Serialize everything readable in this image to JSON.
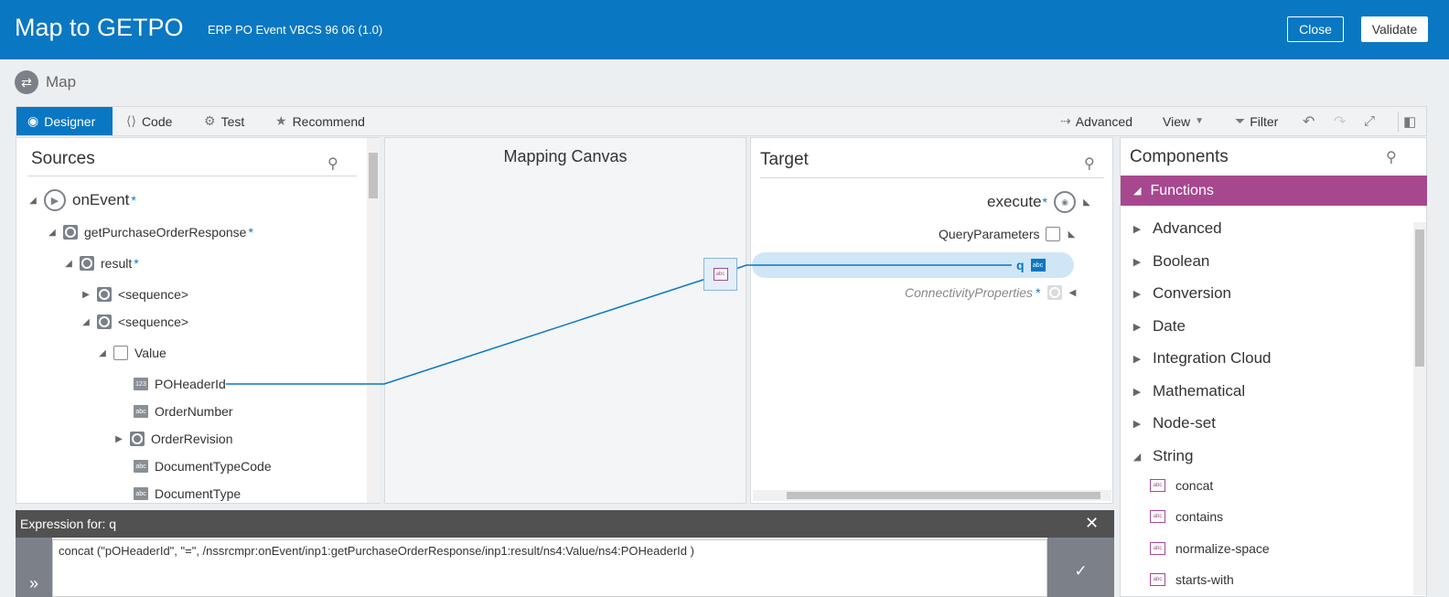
{
  "header": {
    "title": "Map to GETPO",
    "subtitle": "ERP PO Event VBCS 96 06 (1.0)",
    "close_label": "Close",
    "validate_label": "Validate"
  },
  "breadcrumb": {
    "label": "Map"
  },
  "toolbar": {
    "tabs": [
      "Designer",
      "Code",
      "Test",
      "Recommend"
    ],
    "advanced_label": "Advanced",
    "view_label": "View",
    "filter_label": "Filter"
  },
  "sources": {
    "title": "Sources",
    "nodes": {
      "onEvent": "onEvent",
      "getPOResp": "getPurchaseOrderResponse",
      "result": "result",
      "seq1": "<sequence>",
      "seq2": "<sequence>",
      "value": "Value",
      "poHeaderId": "POHeaderId",
      "orderNumber": "OrderNumber",
      "orderRevision": "OrderRevision",
      "docTypeCode": "DocumentTypeCode",
      "docType": "DocumentType"
    },
    "required_mark": "*"
  },
  "canvas": {
    "title": "Mapping Canvas"
  },
  "target": {
    "title": "Target",
    "nodes": {
      "execute": "execute",
      "queryParams": "QueryParameters",
      "q": "q",
      "connProps": "ConnectivityProperties"
    },
    "required_mark": "*"
  },
  "components": {
    "title": "Components",
    "functions_label": "Functions",
    "categories": [
      "Advanced",
      "Boolean",
      "Conversion",
      "Date",
      "Integration Cloud",
      "Mathematical",
      "Node-set",
      "String"
    ],
    "string_functions": [
      "concat",
      "contains",
      "normalize-space",
      "starts-with"
    ]
  },
  "expression": {
    "header": "Expression for: q",
    "value": "concat (\"pOHeaderId\", \"=\", /nssrcmpr:onEvent/inp1:getPurchaseOrderResponse/inp1:result/ns4:Value/ns4:POHeaderId )"
  },
  "icons": {
    "small_type_label": "abc",
    "number_type_label": "123"
  },
  "colors": {
    "header_blue": "#0a77c2",
    "functions_purple": "#a7488f",
    "mapping_line": "#0a77c2",
    "selected_row": "#cfe6f7"
  }
}
